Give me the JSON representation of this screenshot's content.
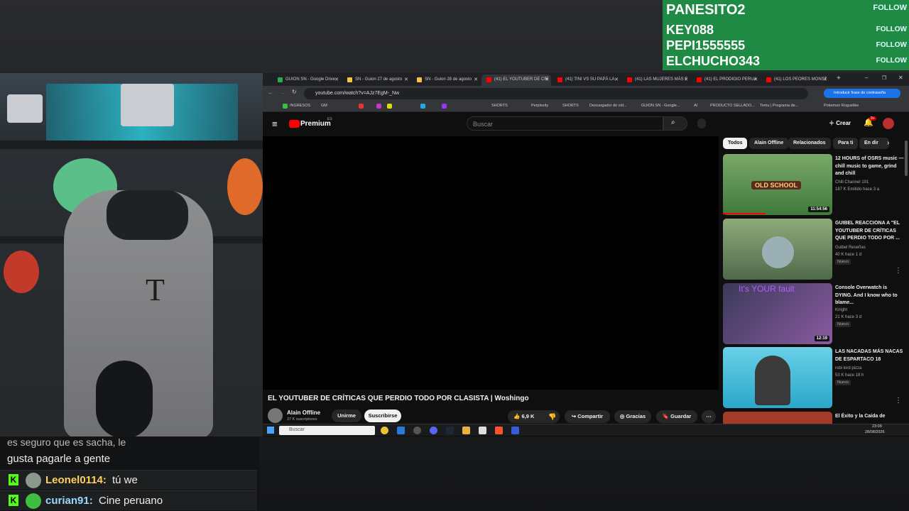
{
  "follows": [
    {
      "name": "PANESITO2",
      "action": "FOLLOW"
    },
    {
      "name": "KEY088",
      "action": "FOLLOW"
    },
    {
      "name": "PEPI1555555",
      "action": "FOLLOW"
    },
    {
      "name": "ELCHUCHO343",
      "action": "FOLLOW"
    }
  ],
  "chat": {
    "partial_line": "es seguro que es sacha, le",
    "partial_line2": "gusta pagarle a gente",
    "messages": [
      {
        "user": "Leonel0114:",
        "text": "tú we",
        "user_color": "#ffd15c"
      },
      {
        "user": "curian91:",
        "text": "Cine peruano",
        "user_color": "#9ad9ff"
      }
    ],
    "badge": "K"
  },
  "browser": {
    "tabs": [
      {
        "label": "GUION SN - Google Drive",
        "color": "#2da94f"
      },
      {
        "label": "SN - Guion 27 de agosto",
        "color": "#f6c342"
      },
      {
        "label": "SN - Guion 28 de agosto",
        "color": "#f6c342"
      },
      {
        "label": "(41) EL YOUTUBER DE CRÍ",
        "color": "#ff0000"
      },
      {
        "label": "(41) TINI VS SU PAPÁ LA",
        "color": "#ff0000"
      },
      {
        "label": "(41) LAS MUJERES MÁS F",
        "color": "#ff0000"
      },
      {
        "label": "(41) EL PRODIGIO PERUA",
        "color": "#ff0000"
      },
      {
        "label": "(41) LOS PEORES MONST",
        "color": "#ff0000"
      }
    ],
    "new_tab": "+",
    "url": "youtube.com/watch?v=AJz7EgM-_Nw",
    "password_hint": "Introducir frase de contraseña",
    "bookmarks": [
      "INGRESOS",
      "GM",
      "SHORTS",
      "Perplexity",
      "SHORTS",
      "Descargador de víd...",
      "GUION SN - Google...",
      "AI",
      "PRODUCTO SELLADO...",
      "Temu | Programa de...",
      "Pokemon Roguelike"
    ]
  },
  "youtube": {
    "logo": "Premium",
    "logo_sup": "ES",
    "search_placeholder": "Buscar",
    "create_label": "Crear",
    "notif_count": "9+",
    "video_title": "EL YOUTUBER DE CRÍTICAS QUE PERDIO TODO POR CLASISTA | Woshingo",
    "channel": "Alain Offline",
    "subs": "37 K suscriptores",
    "unsub_label": "Unirme",
    "subscribed_label": "Suscribirse",
    "likes": "6,9 K",
    "share_label": "Compartir",
    "thanks_label": "Gracias",
    "save_label": "Guardar",
    "chips": [
      "Todos",
      "Alain Offline",
      "Relacionados",
      "Para ti",
      "En dir"
    ],
    "recommendations": [
      {
        "title": "12 HOURS of OSRS music — chill music to game, grind and chill",
        "channel": "Chill Channel 101",
        "meta": "187 K  Emitido hace 3 a",
        "duration": "11:54:56",
        "badge": "",
        "thumb_color": "#3f7a3a"
      },
      {
        "title": "GUIBEL REACCIONA A \"EL YOUTUBER DE CRÍTICAS QUE PERDIO TODO POR ...",
        "channel": "Guibel Reseñas",
        "meta": "40 K  hace 1 d",
        "duration": "",
        "badge": "Nuevo",
        "thumb_color": "#6f8a5c"
      },
      {
        "title": "Console Overwatch is DYING. And I know who to blame...",
        "channel": "Knight",
        "meta": "21 K  hace 3 d",
        "duration": "12:19",
        "badge": "Nuevo",
        "thumb_color": "#5a4a7a"
      },
      {
        "title": "LAS NACADAS MÁS NACAS DE ESPARTACO 18",
        "channel": "robi lord pizza",
        "meta": "53 K  hace 18 h",
        "duration": "",
        "badge": "Nuevo",
        "thumb_color": "#2aa7c9"
      },
      {
        "title": "El Éxito y la Caída de",
        "channel": "",
        "meta": "",
        "duration": "",
        "badge": "",
        "thumb_color": "#a33a2a"
      }
    ],
    "thumb_overlay_1": "OLD SCHOOL",
    "thumb_overlay_3": "It's YOUR fault"
  },
  "taskbar": {
    "search_placeholder": "Buscar",
    "time": "23:09",
    "date": "28/08/2026"
  }
}
